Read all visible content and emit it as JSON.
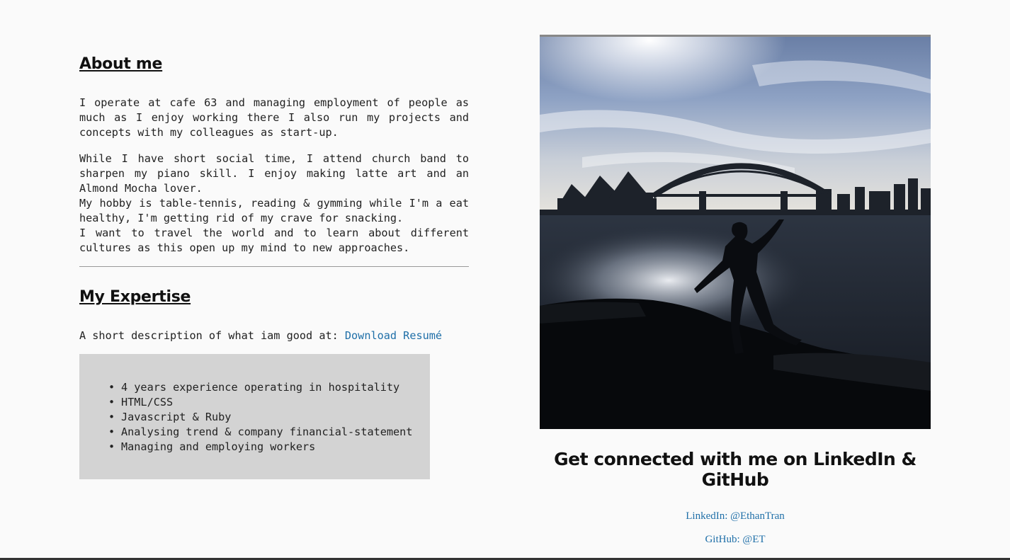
{
  "about": {
    "title": "About me",
    "paragraph1": "I operate at cafe 63 and managing employment of people as much as I enjoy working there I also run my projects and concepts with my colleagues as start-up.",
    "paragraph2_lines": [
      "While I have short social time, I attend church band to sharpen my piano skill. I enjoy making latte art and an Almond Mocha lover.",
      "My hobby is table-tennis, reading & gymming while I'm a eat healthy, I'm getting rid of my crave for snacking.",
      "I want to travel the world and to learn about different cultures as this open up my mind to new approaches."
    ]
  },
  "expertise": {
    "title": "My Expertise",
    "description": "A short description of what iam good at: ",
    "resume_link": "Download Resumé",
    "skills": [
      "4 years experience operating in hospitality",
      "HTML/CSS",
      "Javascript & Ruby",
      "Analysing trend & company financial-statement",
      "Managing and employing workers"
    ]
  },
  "connect": {
    "title": "Get connected with me on LinkedIn & GitHub",
    "linkedin": "LinkedIn: @EthanTran",
    "github": "GitHub: @ET"
  },
  "colors": {
    "background": "#fafafa",
    "link": "#1f6fa8",
    "skills_box": "#d3d3d3"
  }
}
